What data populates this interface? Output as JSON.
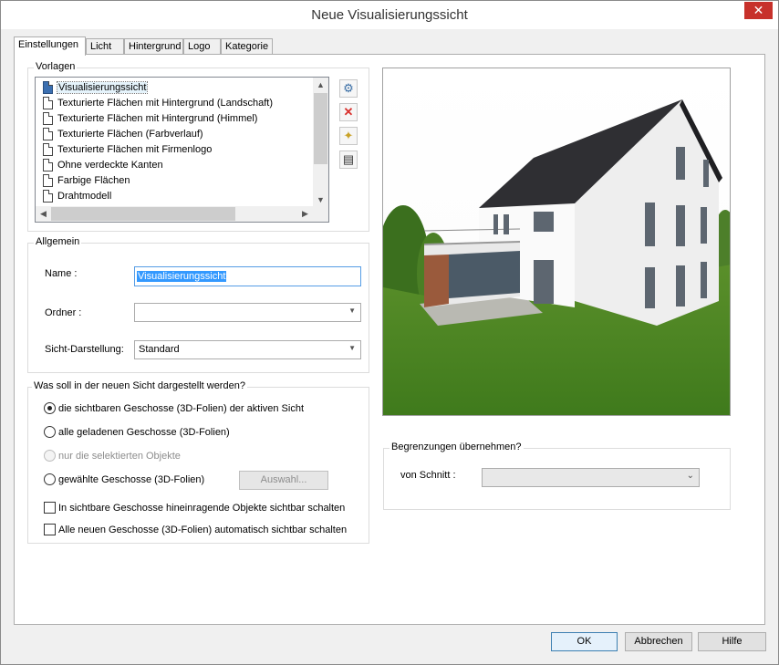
{
  "window": {
    "title": "Neue Visualisierungssicht",
    "close_glyph": "✕"
  },
  "tabs": [
    {
      "label": "Einstellungen",
      "active": true
    },
    {
      "label": "Licht"
    },
    {
      "label": "Hintergrund"
    },
    {
      "label": "Logo"
    },
    {
      "label": "Kategorie"
    }
  ],
  "vorlagen": {
    "title": "Vorlagen",
    "items": [
      "Visualisierungssicht",
      "Texturierte Flächen mit Hintergrund (Landschaft)",
      "Texturierte Flächen mit Hintergrund (Himmel)",
      "Texturierte Flächen (Farbverlauf)",
      "Texturierte Flächen mit Firmenlogo",
      "Ohne verdeckte Kanten",
      "Farbige Flächen",
      "Drahtmodell"
    ],
    "selected_index": 0,
    "side_buttons": [
      "settings-icon",
      "delete-icon",
      "new-template-icon",
      "print-icon"
    ]
  },
  "allgemein": {
    "title": "Allgemein",
    "name_label": "Name :",
    "name_value": "Visualisierungssicht",
    "ordner_label": "Ordner :",
    "ordner_value": "",
    "darstellung_label": "Sicht-Darstellung:",
    "darstellung_value": "Standard"
  },
  "darstellen": {
    "title": "Was soll in der neuen Sicht dargestellt werden?",
    "options": [
      {
        "label": "die sichtbaren Geschosse (3D-Folien) der aktiven Sicht",
        "checked": true,
        "disabled": false
      },
      {
        "label": "alle geladenen Geschosse (3D-Folien)",
        "checked": false,
        "disabled": false
      },
      {
        "label": "nur die selektierten Objekte",
        "checked": false,
        "disabled": true
      },
      {
        "label": "gewählte Geschosse (3D-Folien)",
        "checked": false,
        "disabled": false
      }
    ],
    "auswahl_button": "Auswahl...",
    "checkboxes": [
      {
        "label": "In sichtbare Geschosse hineinragende Objekte sichtbar schalten",
        "checked": false
      },
      {
        "label": "Alle neuen Geschosse (3D-Folien) automatisch sichtbar schalten",
        "checked": false
      }
    ]
  },
  "begrenzungen": {
    "title": "Begrenzungen übernehmen?",
    "schnitt_label": "von Schnitt :",
    "schnitt_value": ""
  },
  "preview": {
    "description": "3D-Vorschau Haus"
  },
  "footer": {
    "ok": "OK",
    "cancel": "Abbrechen",
    "help": "Hilfe"
  }
}
